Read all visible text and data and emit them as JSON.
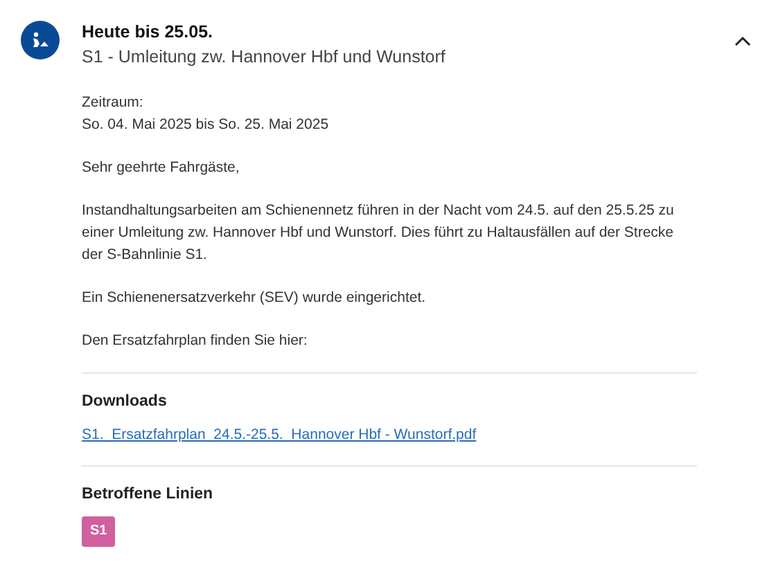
{
  "notice": {
    "title": "Heute bis 25.05.",
    "subtitle": "S1 - Umleitung zw. Hannover Hbf und Wunstorf",
    "expanded": true,
    "period_label": "Zeitraum:",
    "period": "So. 04. Mai 2025 bis So. 25. Mai 2025",
    "paragraphs": [
      "Sehr geehrte Fahrgäste,",
      "Instandhaltungsarbeiten am Schienennetz führen in der Nacht vom 24.5. auf den 25.5.25 zu einer Umleitung zw. Hannover Hbf und Wunstorf. Dies führt zu Haltausfällen auf der Strecke der S-Bahnlinie S1.",
      "Ein Schienenersatzverkehr (SEV) wurde eingerichtet.",
      "Den Ersatzfahrplan finden Sie hier:"
    ],
    "downloads": {
      "heading": "Downloads",
      "files": [
        "S1._Ersatzfahrplan_24.5.-25.5._Hannover Hbf - Wunstorf.pdf"
      ]
    },
    "affected_lines": {
      "heading": "Betroffene Linien",
      "lines": [
        {
          "label": "S1",
          "color": "#d0609f"
        }
      ]
    }
  }
}
